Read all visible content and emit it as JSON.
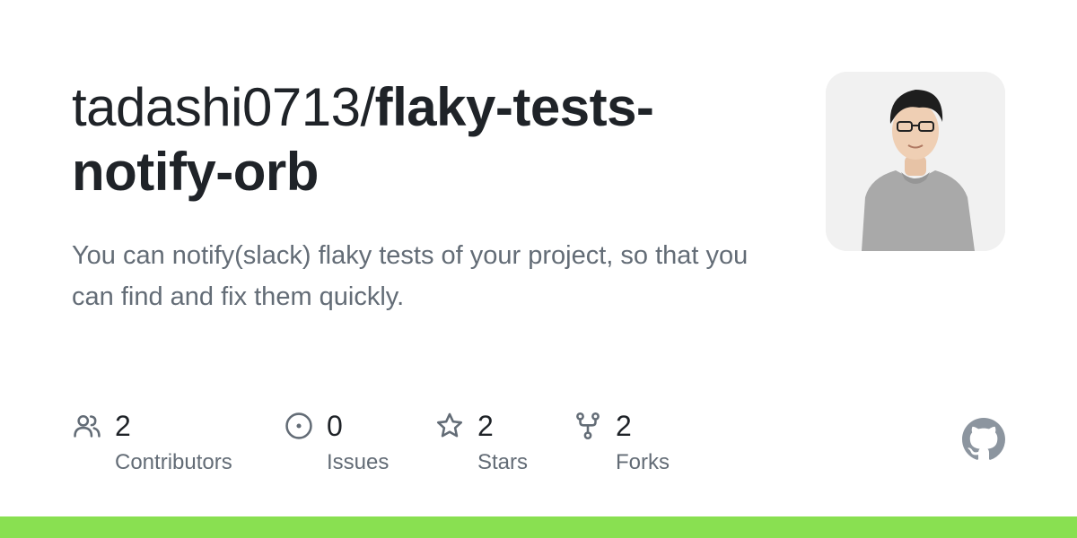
{
  "repo": {
    "owner": "tadashi0713/",
    "name_line1": "flaky-tests-",
    "name_line2": "notify-orb",
    "description": "You can notify(slack) flaky tests of your project, so that you can find and fix them quickly."
  },
  "avatar": {
    "icon": "user-avatar-photo"
  },
  "stats": [
    {
      "icon": "people-icon",
      "count": "2",
      "label": "Contributors"
    },
    {
      "icon": "issue-opened-icon",
      "count": "0",
      "label": "Issues"
    },
    {
      "icon": "star-icon",
      "count": "2",
      "label": "Stars"
    },
    {
      "icon": "repo-forked-icon",
      "count": "2",
      "label": "Forks"
    }
  ],
  "brand": {
    "logo": "github-mark-icon",
    "logo_color": "#8c959f",
    "language_bar_color": "#89e051"
  }
}
